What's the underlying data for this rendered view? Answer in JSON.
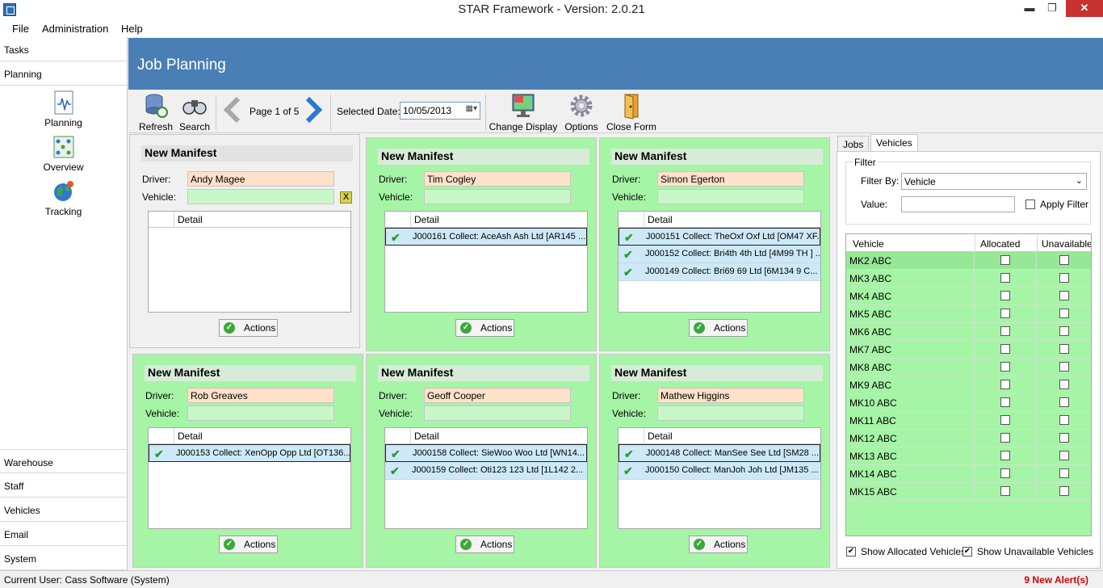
{
  "window": {
    "title": "STAR Framework - Version: 2.0.21",
    "minimize": "▬",
    "maximize": "❐",
    "close": "✕"
  },
  "menu": [
    "File",
    "Administration",
    "Help"
  ],
  "sidebar": {
    "top_sections": [
      "Tasks",
      "Planning"
    ],
    "planning_items": [
      "Planning",
      "Overview",
      "Tracking"
    ],
    "bottom_sections": [
      "Warehouse",
      "Staff",
      "Vehicles",
      "Email",
      "System"
    ]
  },
  "header": {
    "title": "Job Planning"
  },
  "toolbar": {
    "refresh": "Refresh",
    "search": "Search",
    "page_label": "Page 1 of 5",
    "selected_date_label": "Selected Date:",
    "date_value": "10/05/2013",
    "change_display": "Change Display",
    "options": "Options",
    "close_form": "Close Form"
  },
  "manifests": [
    {
      "title": "New Manifest",
      "driver_label": "Driver:",
      "driver": "Andy  Magee",
      "vehicle_label": "Vehicle:",
      "vehicle": "",
      "clear_icon": "X",
      "detail_header": "Detail",
      "jobs": [],
      "actions": "Actions"
    },
    {
      "title": "New Manifest",
      "driver_label": "Driver:",
      "driver": "Tim Cogley",
      "vehicle_label": "Vehicle:",
      "vehicle": "",
      "detail_header": "Detail",
      "jobs": [
        "J000161 Collect: AceAsh Ash Ltd [AR145 ..."
      ],
      "actions": "Actions"
    },
    {
      "title": "New Manifest",
      "driver_label": "Driver:",
      "driver": "Simon Egerton",
      "vehicle_label": "Vehicle:",
      "vehicle": "",
      "detail_header": "Detail",
      "jobs": [
        "J000151 Collect: TheOxf Oxf Ltd [OM47 XF...",
        "J000152 Collect: Bri4th 4th Ltd [4M99 TH ] ...",
        "J000149 Collect: Bri69  69  Ltd [6M134 9 C..."
      ],
      "actions": "Actions"
    },
    {
      "title": "New Manifest",
      "driver_label": "Driver:",
      "driver": "Rob Greaves",
      "vehicle_label": "Vehicle:",
      "vehicle": "",
      "detail_header": "Detail",
      "jobs": [
        "J000153 Collect: XenOpp Opp Ltd [OT136..."
      ],
      "actions": "Actions"
    },
    {
      "title": "New Manifest",
      "driver_label": "Driver:",
      "driver": "Geoff Cooper",
      "vehicle_label": "Vehicle:",
      "vehicle": "",
      "detail_header": "Detail",
      "jobs": [
        "J000158 Collect: SieWoo Woo Ltd [WN14...",
        "J000159 Collect: Oti123 123 Ltd [1L142 2..."
      ],
      "actions": "Actions"
    },
    {
      "title": "New Manifest",
      "driver_label": "Driver:",
      "driver": "Mathew Higgins",
      "vehicle_label": "Vehicle:",
      "vehicle": "",
      "detail_header": "Detail",
      "jobs": [
        "J000148 Collect: ManSee See Ltd [SM28 ...",
        "J000150 Collect: ManJoh Joh Ltd [JM135 ..."
      ],
      "actions": "Actions"
    }
  ],
  "right_panel": {
    "tabs": [
      "Jobs",
      "Vehicles"
    ],
    "active_tab": "Vehicles",
    "filter": {
      "legend": "Filter",
      "filter_by_label": "Filter By:",
      "filter_by_value": "Vehicle",
      "value_label": "Value:",
      "value": "",
      "apply_label": "Apply Filter",
      "apply_checked": false
    },
    "table": {
      "headers": [
        "Vehicle",
        "Allocated",
        "Unavailable"
      ],
      "rows": [
        "MK2 ABC",
        "MK3 ABC",
        "MK4 ABC",
        "MK5 ABC",
        "MK6 ABC",
        "MK7 ABC",
        "MK8 ABC",
        "MK9 ABC",
        "MK10 ABC",
        "MK11 ABC",
        "MK12 ABC",
        "MK13 ABC",
        "MK14 ABC",
        "MK15 ABC"
      ]
    },
    "show_allocated": "Show Allocated Vehicles",
    "show_unavailable": "Show Unavailable Vehicles",
    "show_allocated_checked": true,
    "show_unavailable_checked": true
  },
  "status": {
    "user": "Current User: Cass Software (System)",
    "alerts": "9 New Alert(s)",
    "alert_color": "#d00000"
  }
}
